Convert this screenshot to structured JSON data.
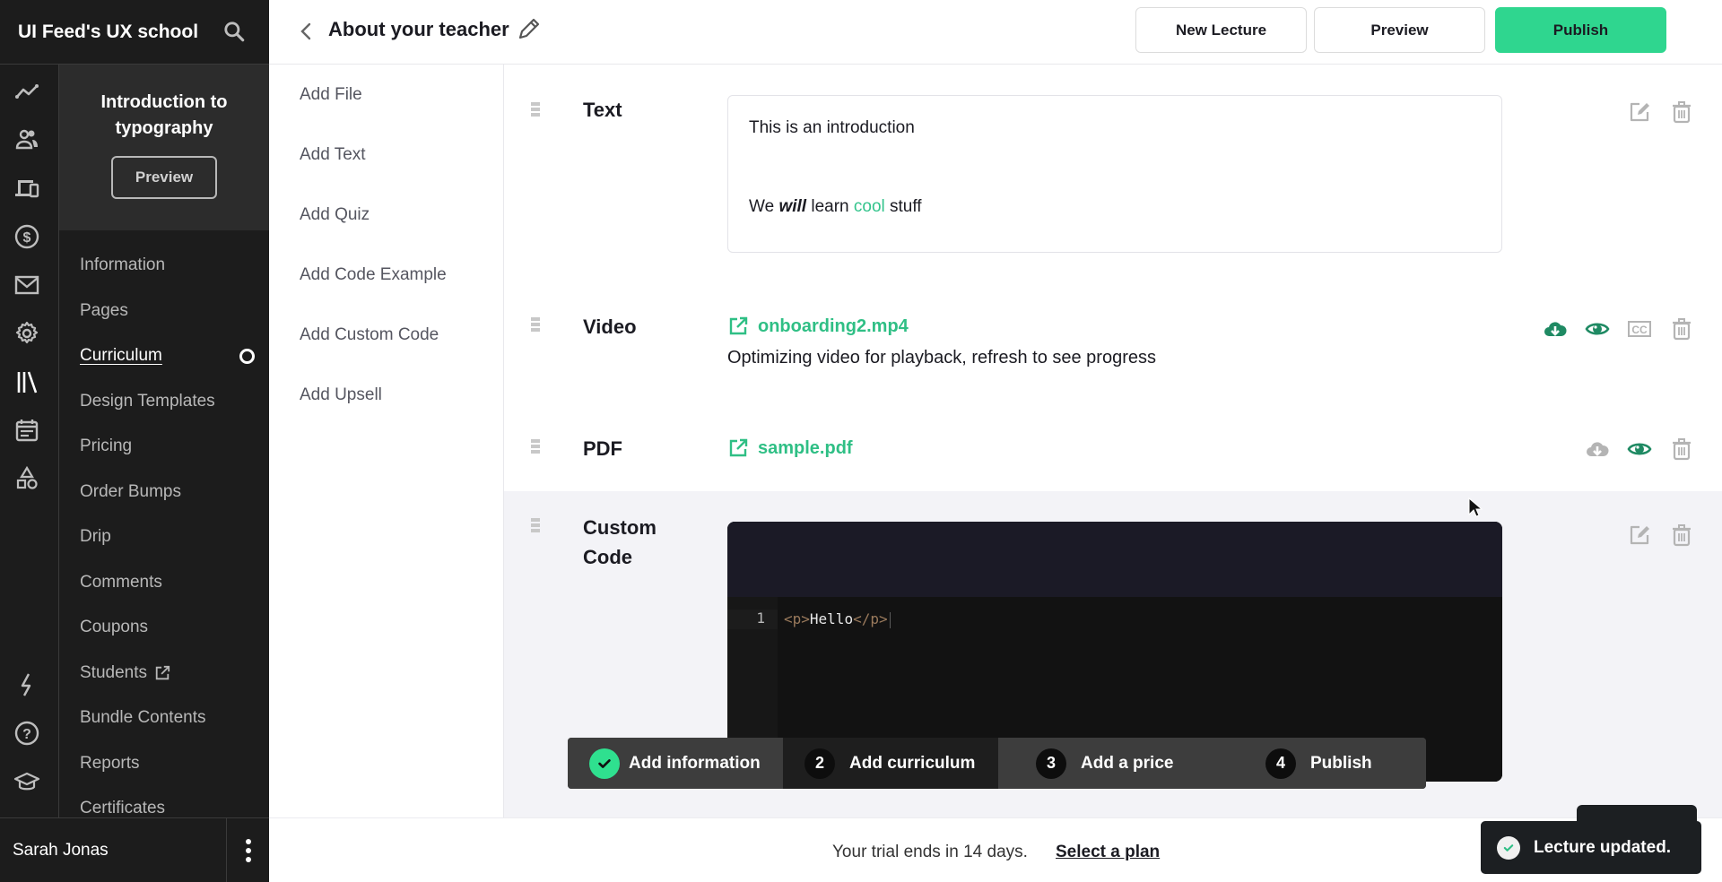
{
  "brand": {
    "title": "UI Feed's UX school",
    "search_icon": "search-icon"
  },
  "rail_icons": [
    "analytics-icon",
    "users-icon",
    "devices-icon",
    "dollar-icon",
    "mail-icon",
    "gear-icon",
    "library-icon",
    "calendar-icon",
    "shapes-icon",
    "lightning-icon",
    "help-icon",
    "graduation-cap-icon"
  ],
  "course": {
    "title": "Introduction to typography",
    "preview_label": "Preview"
  },
  "nav": {
    "items": [
      {
        "label": "Information",
        "active": false
      },
      {
        "label": "Pages",
        "active": false
      },
      {
        "label": "Curriculum",
        "active": true
      },
      {
        "label": "Design Templates",
        "active": false
      },
      {
        "label": "Pricing",
        "active": false
      },
      {
        "label": "Order Bumps",
        "active": false
      },
      {
        "label": "Drip",
        "active": false
      },
      {
        "label": "Comments",
        "active": false
      },
      {
        "label": "Coupons",
        "active": false
      },
      {
        "label": "Students",
        "active": false,
        "external": true
      },
      {
        "label": "Bundle Contents",
        "active": false
      },
      {
        "label": "Reports",
        "active": false
      },
      {
        "label": "Certificates",
        "active": false
      }
    ]
  },
  "user": {
    "name": "Sarah Jonas"
  },
  "header": {
    "title": "About your teacher",
    "new_lecture_label": "New Lecture",
    "preview_label": "Preview",
    "publish_label": "Publish"
  },
  "add_menu": {
    "items": [
      "Add File",
      "Add Text",
      "Add Quiz",
      "Add Code Example",
      "Add Custom Code",
      "Add Upsell"
    ]
  },
  "blocks": {
    "text": {
      "label": "Text",
      "line1": "This is an introduction",
      "line2_pre": "We ",
      "line2_em": "will",
      "line2_mid": " learn ",
      "line2_accent": "cool",
      "line2_post": " stuff"
    },
    "video": {
      "label": "Video",
      "file": "onboarding2.mp4",
      "note": "Optimizing video for playback, refresh to see progress"
    },
    "pdf": {
      "label": "PDF",
      "file": "sample.pdf"
    },
    "custom_code": {
      "label": "Custom Code",
      "line_number": "1",
      "code_open_tag": "<p>",
      "code_text": "Hello",
      "code_close_tag": "</p>"
    }
  },
  "steps": [
    {
      "number": "",
      "label": "Add information",
      "done": true
    },
    {
      "number": "2",
      "label": "Add curriculum",
      "done": false
    },
    {
      "number": "3",
      "label": "Add a price",
      "done": false
    },
    {
      "number": "4",
      "label": "Publish",
      "done": false
    }
  ],
  "trial": {
    "text": "Your trial ends in 14 days.",
    "link": "Select a plan"
  },
  "toast": {
    "message": "Lecture updated."
  },
  "colors": {
    "accent": "#2fd68f",
    "link": "#2fbf85",
    "icon_active": "#1f8a63",
    "icon_muted": "#b4b4b4",
    "sidebar_bg": "#1c1c1c"
  }
}
